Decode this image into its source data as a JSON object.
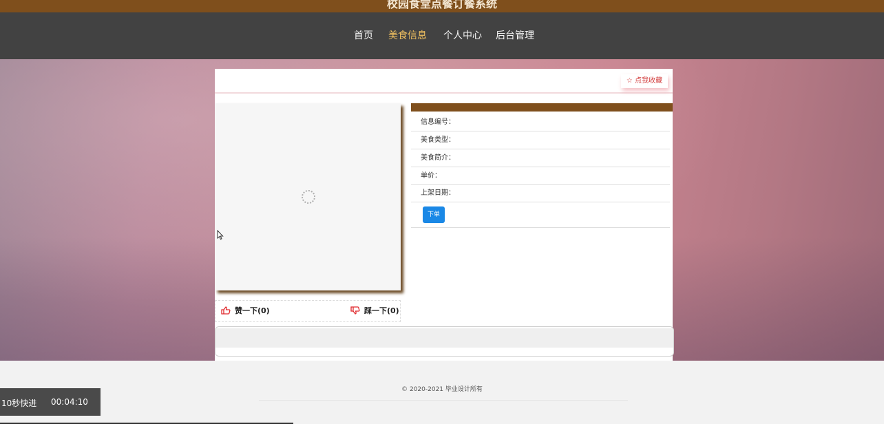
{
  "app": {
    "title": "校园食堂点餐订餐系统"
  },
  "nav": {
    "items": [
      {
        "label": "首页"
      },
      {
        "label": "美食信息"
      },
      {
        "label": "个人中心"
      },
      {
        "label": "后台管理"
      }
    ],
    "active_index": 1
  },
  "detail": {
    "favorite_label": "☆ 点我收藏",
    "like_label": "赞一下(0)",
    "dislike_label": "踩一下(0)",
    "fields": [
      {
        "label": "信息编号："
      },
      {
        "label": "美食类型："
      },
      {
        "label": "美食简介："
      },
      {
        "label": "单价："
      },
      {
        "label": "上架日期："
      }
    ],
    "order_button": "下单"
  },
  "footer": {
    "copyright": "© 2020-2021 毕业设计所有"
  },
  "player": {
    "skip_label": "10秒快进",
    "time": "00:04:10"
  },
  "colors": {
    "brand": "#7f4f1c",
    "nav_bg": "#424242",
    "active_nav": "#f0c060",
    "button": "#1a88e6"
  }
}
